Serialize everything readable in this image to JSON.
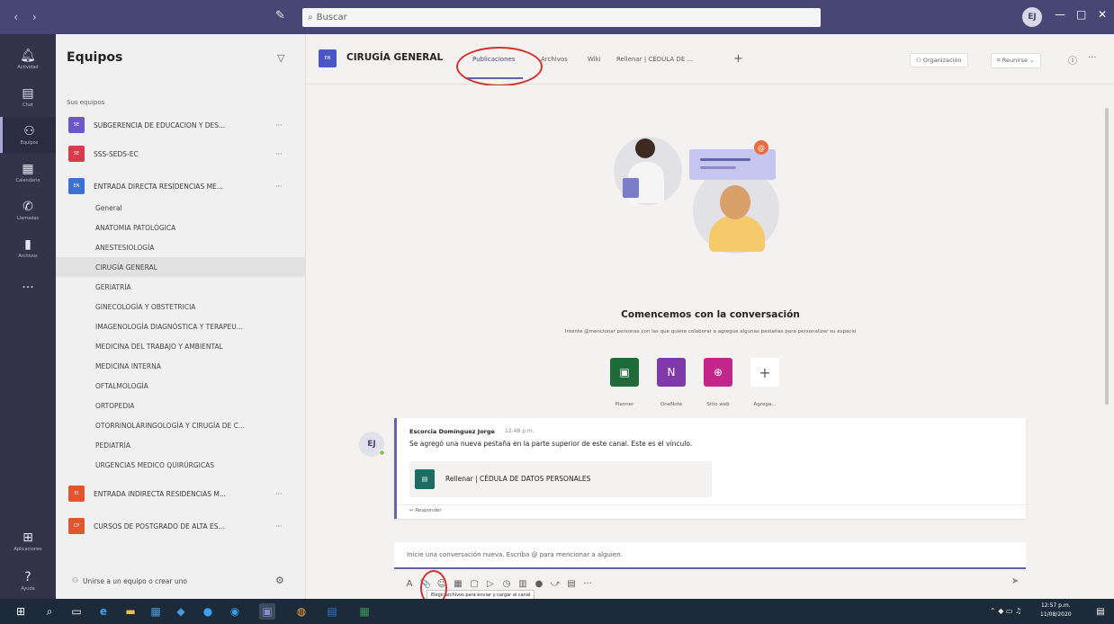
{
  "titlebar": {
    "nav": "‹ ›",
    "search_placeholder": "Buscar",
    "avatar_initials": "EJ",
    "minimize": "—",
    "maximize": "□",
    "close": "✕"
  },
  "rail": [
    {
      "label": "Actividad",
      "icon": "bell-icon"
    },
    {
      "label": "Chat",
      "icon": "chat-icon"
    },
    {
      "label": "Equipos",
      "icon": "teams-icon"
    },
    {
      "label": "Calendario",
      "icon": "calendar-icon"
    },
    {
      "label": "Llamadas",
      "icon": "phone-icon"
    },
    {
      "label": "Archivos",
      "icon": "files-icon"
    },
    {
      "label": "",
      "icon": "more-icon"
    }
  ],
  "rail_bottom": [
    {
      "label": "Aplicaciones",
      "icon": "apps-icon"
    },
    {
      "label": "Ayuda",
      "icon": "help-icon"
    }
  ],
  "teams_panel": {
    "title": "Equipos",
    "section_label": "Sus equipos",
    "teams": [
      {
        "name": "SUBGERENCIA DE EDUCACION Y DES...",
        "logo": "SE",
        "color": "#6b57c7"
      },
      {
        "name": "SSS-SEDS-EC",
        "logo": "SE",
        "color": "#d83b4b"
      },
      {
        "name": "ENTRADA DIRECTA RESIDENCIAS ME...",
        "logo": "EN",
        "color": "#3a72d4"
      }
    ],
    "channels": [
      "General",
      "ANATOMIA PATOLÓGICA",
      "ANESTESIOLOGÍA",
      "CIRUGÍA GENERAL",
      "GERIATRÍA",
      "GINECOLOGÍA Y OBSTETRICIA",
      "IMAGENOLOGÍA DIAGNÓSTICA Y TERAPEU...",
      "MEDICINA DEL TRABAJO Y AMBIENTAL",
      "MEDICINA INTERNA",
      "OFTALMOLOGÍA",
      "ORTOPEDIA",
      "OTORRINOLARINGOLOGÍA Y CIRUGÍA DE C...",
      "PEDIATRÍA",
      "URGENCIAS MEDICO QUIRÚRGICAS"
    ],
    "teams_after": [
      {
        "name": "ENTRADA INDIRECTA RESIDENCIAS M...",
        "logo": "EI",
        "color": "#e0562f"
      },
      {
        "name": "CURSOS DE POSTGRADO DE ALTA ES...",
        "logo": "CP",
        "color": "#e0562f"
      }
    ],
    "join_text": "Unirse a un equipo o crear uno",
    "more": "···"
  },
  "channel_header": {
    "logo": "EN",
    "title": "CIRUGÍA GENERAL",
    "tabs": [
      "Publicaciones",
      "Archivos",
      "Wiki",
      "Rellenar | CÉDULA DE ..."
    ],
    "org_button": "Organización",
    "meet_button": "Reunirse",
    "info": "ⓘ",
    "more": "···"
  },
  "welcome": {
    "title": "Comencemos con la conversación",
    "subtitle": "Intente @mencionar personas con las que quiere colaborar o agregue algunas pestañas para personalizar su espacio",
    "apps": [
      {
        "label": "Planner",
        "color": "#1e6b3a",
        "glyph": "▣"
      },
      {
        "label": "OneNote",
        "color": "#7f3aa8",
        "glyph": "N"
      },
      {
        "label": "Sitio web",
        "color": "#c2268a",
        "glyph": "⊕"
      },
      {
        "label": "Agrega...",
        "color": "#ffffff",
        "glyph": "+"
      }
    ]
  },
  "message": {
    "avatar": "EJ",
    "author": "Escorcia Domínguez Jorge",
    "time": "12:48 p.m.",
    "text": "Se agregó una nueva pestaña en la parte superior de este canal. Este es el vínculo.",
    "attachment": "Rellenar | CÉDULA DE DATOS PERSONALES",
    "reply": "↩ Responder"
  },
  "compose": {
    "placeholder": "Inicie una conversación nueva. Escriba @ para mencionar a alguien.",
    "tooltip": "Elegir archivos para enviar y cargar al canal",
    "tools": [
      "A",
      "📎",
      "☺",
      "▦",
      "▢",
      "▷",
      "◷",
      "▥",
      "●",
      "⤻",
      "▤",
      "···"
    ],
    "send": "➤"
  },
  "taskbar": {
    "time": "12:57 p.m.",
    "date": "11/08/2020"
  }
}
